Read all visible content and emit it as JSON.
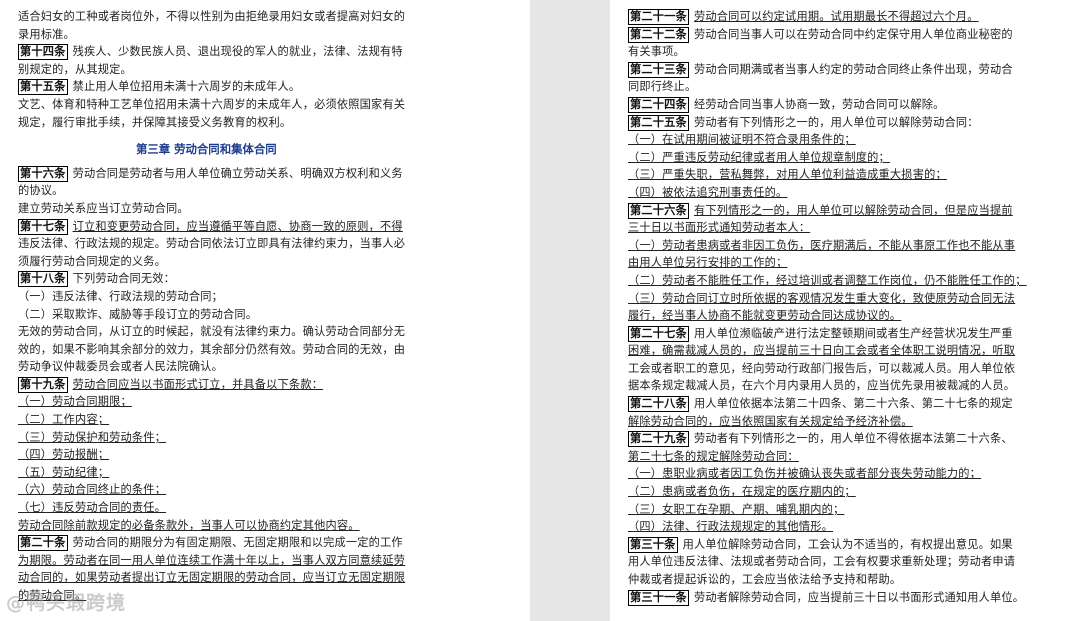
{
  "left_page": {
    "lines": [
      {
        "article": "",
        "text": "适合妇女的工种或者岗位外，不得以性别为由拒绝录用妇女或者提高对妇女的",
        "underline": false
      },
      {
        "article": "",
        "text": "录用标准。",
        "underline": false
      },
      {
        "article": "第十四条",
        "text": "残疾人、少数民族人员、退出现役的军人的就业，法律、法规有特",
        "underline": false
      },
      {
        "article": "",
        "text": "别规定的，从其规定。",
        "underline": false
      },
      {
        "article": "第十五条",
        "text": "禁止用人单位招用未满十六周岁的未成年人。",
        "underline": false
      },
      {
        "article": "",
        "text": "文艺、体育和特种工艺单位招用未满十六周岁的未成年人，必须依照国家有关",
        "underline": false
      },
      {
        "article": "",
        "text": "规定，履行审批手续，并保障其接受义务教育的权利。",
        "underline": false
      }
    ],
    "chapter_title": "第三章 劳动合同和集体合同",
    "lines2": [
      {
        "article": "第十六条",
        "text": "劳动合同是劳动者与用人单位确立劳动关系、明确双方权利和义务",
        "underline": false
      },
      {
        "article": "",
        "text": "的协议。",
        "underline": false
      },
      {
        "article": "",
        "text": "建立劳动关系应当订立劳动合同。",
        "underline": false
      },
      {
        "article": "第十七条",
        "text": "订立和变更劳动合同，应当遵循平等自愿、协商一致的原则，不得",
        "underline": true
      },
      {
        "article": "",
        "text": "违反法律、行政法规的规定。劳动合同依法订立即具有法律约束力，当事人必",
        "underline": false
      },
      {
        "article": "",
        "text": "须履行劳动合同规定的义务。",
        "underline": false
      },
      {
        "article": "第十八条",
        "text": "下列劳动合同无效：",
        "underline": false
      },
      {
        "article": "",
        "text": "（一）违反法律、行政法规的劳动合同；",
        "underline": false
      },
      {
        "article": "",
        "text": "（二）采取欺诈、威胁等手段订立的劳动合同。",
        "underline": false
      },
      {
        "article": "",
        "text": "无效的劳动合同，从订立的时候起，就没有法律约束力。确认劳动合同部分无",
        "underline": false
      },
      {
        "article": "",
        "text": "效的，如果不影响其余部分的效力，其余部分仍然有效。劳动合同的无效，由",
        "underline": false
      },
      {
        "article": "",
        "text": "劳动争议仲裁委员会或者人民法院确认。",
        "underline": false
      },
      {
        "article": "第十九条",
        "text": "劳动合同应当以书面形式订立，并具备以下条款：",
        "underline": true
      },
      {
        "article": "",
        "text": "（一）劳动合同期限；",
        "underline": true
      },
      {
        "article": "",
        "text": "（二）工作内容；",
        "underline": true
      },
      {
        "article": "",
        "text": "（三）劳动保护和劳动条件；",
        "underline": true
      },
      {
        "article": "",
        "text": "（四）劳动报酬；",
        "underline": true
      },
      {
        "article": "",
        "text": "（五）劳动纪律；",
        "underline": true
      },
      {
        "article": "",
        "text": "（六）劳动合同终止的条件；",
        "underline": true
      },
      {
        "article": "",
        "text": "（七）违反劳动合同的责任。",
        "underline": true
      },
      {
        "article": "",
        "text": "劳动合同除前款规定的必备条款外，当事人可以协商约定其他内容。",
        "underline": true
      },
      {
        "article": "第二十条",
        "text": "劳动合同的期限分为有固定期限、无固定期限和以完成一定的工作",
        "underline": false
      },
      {
        "article": "",
        "text": "为期限。劳动者在同一用人单位连续工作满十年以上，当事人双方同意续延劳",
        "underline": true
      },
      {
        "article": "",
        "text": "动合同的，如果劳动者提出订立无固定期限的劳动合同，应当订立无固定期限",
        "underline": true
      },
      {
        "article": "",
        "text": "的劳动合同。",
        "underline": true
      }
    ],
    "watermark": "@鸭头瑕跨境"
  },
  "right_page": {
    "lines": [
      {
        "article": "第二十一条",
        "text": "劳动合同可以约定试用期。试用期最长不得超过六个月。",
        "underline": true
      },
      {
        "article": "第二十二条",
        "text": "劳动合同当事人可以在劳动合同中约定保守用人单位商业秘密的",
        "underline": false
      },
      {
        "article": "",
        "text": "有关事项。",
        "underline": false
      },
      {
        "article": "第二十三条",
        "text": "劳动合同期满或者当事人约定的劳动合同终止条件出现，劳动合",
        "underline": false
      },
      {
        "article": "",
        "text": "同即行终止。",
        "underline": false
      },
      {
        "article": "第二十四条",
        "text": "经劳动合同当事人协商一致，劳动合同可以解除。",
        "underline": false
      },
      {
        "article": "第二十五条",
        "text": "劳动者有下列情形之一的，用人单位可以解除劳动合同：",
        "underline": false
      },
      {
        "article": "",
        "text": "（一）在试用期间被证明不符合录用条件的；",
        "underline": true
      },
      {
        "article": "",
        "text": "（二）严重违反劳动纪律或者用人单位规章制度的；",
        "underline": true
      },
      {
        "article": "",
        "text": "（三）严重失职，营私舞弊，对用人单位利益造成重大损害的；",
        "underline": true
      },
      {
        "article": "",
        "text": "（四）被依法追究刑事责任的。",
        "underline": true
      },
      {
        "article": "第二十六条",
        "text": "有下列情形之一的，用人单位可以解除劳动合同，但是应当提前",
        "underline": true
      },
      {
        "article": "",
        "text": "三十日以书面形式通知劳动者本人：",
        "underline": true
      },
      {
        "article": "",
        "text": "（一）劳动者患病或者非因工负伤，医疗期满后，不能从事原工作也不能从事",
        "underline": true
      },
      {
        "article": "",
        "text": "由用人单位另行安排的工作的；",
        "underline": true
      },
      {
        "article": "",
        "text": "（二）劳动者不能胜任工作，经过培训或者调整工作岗位，仍不能胜任工作的；",
        "underline": true
      },
      {
        "article": "",
        "text": "（三）劳动合同订立时所依据的客观情况发生重大变化，致使原劳动合同无法",
        "underline": true
      },
      {
        "article": "",
        "text": "履行，经当事人协商不能就变更劳动合同达成协议的。",
        "underline": true
      },
      {
        "article": "第二十七条",
        "text": "用人单位濒临破产进行法定整顿期间或者生产经营状况发生严重",
        "underline": false
      },
      {
        "article": "",
        "text": "困难，确需裁减人员的，应当提前三十日向工会或者全体职工说明情况，听取",
        "underline": true
      },
      {
        "article": "",
        "text": "工会或者职工的意见，经向劳动行政部门报告后，可以裁减人员。用人单位依",
        "underline": false
      },
      {
        "article": "",
        "text": "据本条规定裁减人员，在六个月内录用人员的，应当优先录用被裁减的人员。",
        "underline": false
      },
      {
        "article": "第二十八条",
        "text": "用人单位依据本法第二十四条、第二十六条、第二十七条的规定",
        "underline": false
      },
      {
        "article": "",
        "text": "解除劳动合同的，应当依照国家有关规定给予经济补偿。",
        "underline": true
      },
      {
        "article": "第二十九条",
        "text": "劳动者有下列情形之一的，用人单位不得依据本法第二十六条、",
        "underline": false
      },
      {
        "article": "",
        "text": "第二十七条的规定解除劳动合同：",
        "underline": true
      },
      {
        "article": "",
        "text": "（一）患职业病或者因工负伤并被确认丧失或者部分丧失劳动能力的；",
        "underline": true
      },
      {
        "article": "",
        "text": "（二）患病或者负伤，在规定的医疗期内的；",
        "underline": true
      },
      {
        "article": "",
        "text": "（三）女职工在孕期、产期、哺乳期内的；",
        "underline": true
      },
      {
        "article": "",
        "text": "（四）法律、行政法规规定的其他情形。",
        "underline": true
      },
      {
        "article": "第三十条",
        "text": "用人单位解除劳动合同，工会认为不适当的，有权提出意见。如果",
        "underline": false
      },
      {
        "article": "",
        "text": "用人单位违反法律、法规或者劳动合同，工会有权要求重新处理；劳动者申请",
        "underline": false
      },
      {
        "article": "",
        "text": "仲裁或者提起诉讼的，工会应当依法给予支持和帮助。",
        "underline": false
      },
      {
        "article": "第三十一条",
        "text": "劳动者解除劳动合同，应当提前三十日以书面形式通知用人单位。",
        "underline": false
      }
    ]
  }
}
